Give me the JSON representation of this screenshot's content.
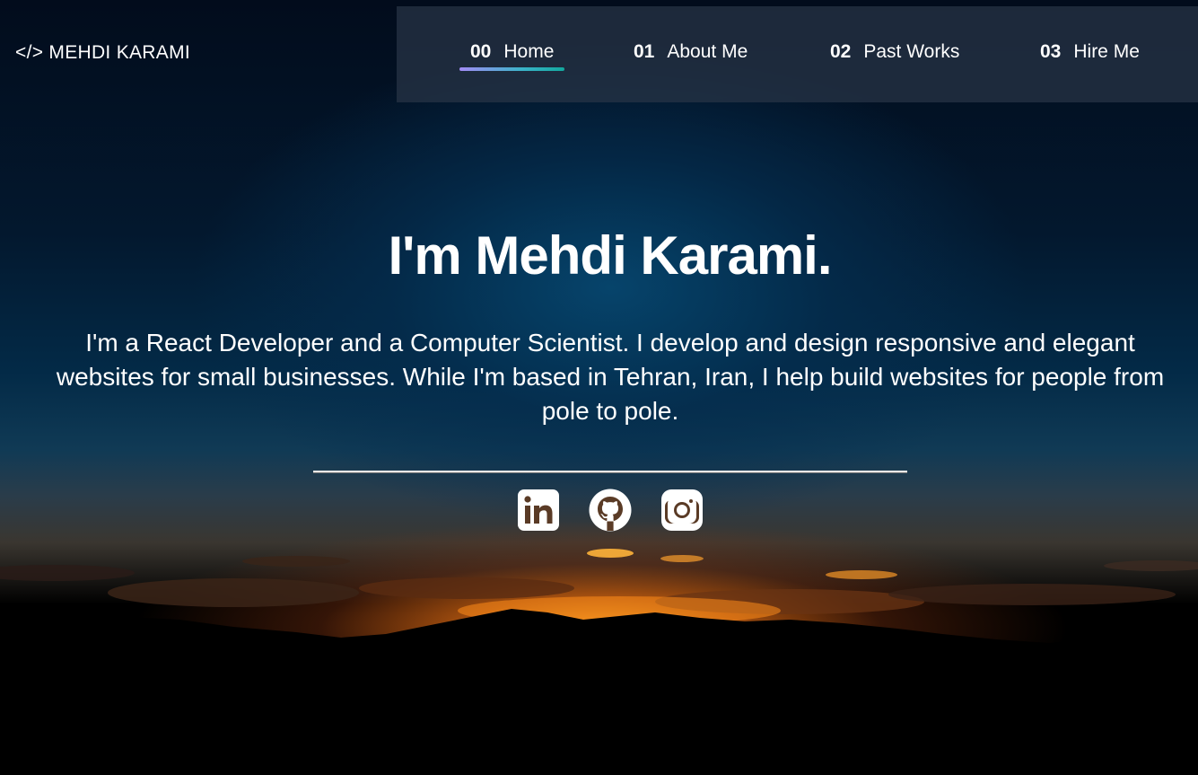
{
  "header": {
    "logo_text": "</> MEHDI KARAMI"
  },
  "nav": {
    "items": [
      {
        "num": "00",
        "label": "Home",
        "active": true
      },
      {
        "num": "01",
        "label": "About Me",
        "active": false
      },
      {
        "num": "02",
        "label": "Past Works",
        "active": false
      },
      {
        "num": "03",
        "label": "Hire Me",
        "active": false
      }
    ],
    "active_underline_colors": [
      "#a38cf5",
      "#13a89e"
    ]
  },
  "hero": {
    "title": "I'm Mehdi Karami.",
    "description": "I'm a React Developer and a Computer Scientist. I develop and design responsive and elegant websites for small businesses. While I'm based in Tehran, Iran, I help build websites for people from pole to pole."
  },
  "socials": [
    {
      "icon": "linkedin-icon"
    },
    {
      "icon": "github-icon"
    },
    {
      "icon": "instagram-icon"
    }
  ]
}
